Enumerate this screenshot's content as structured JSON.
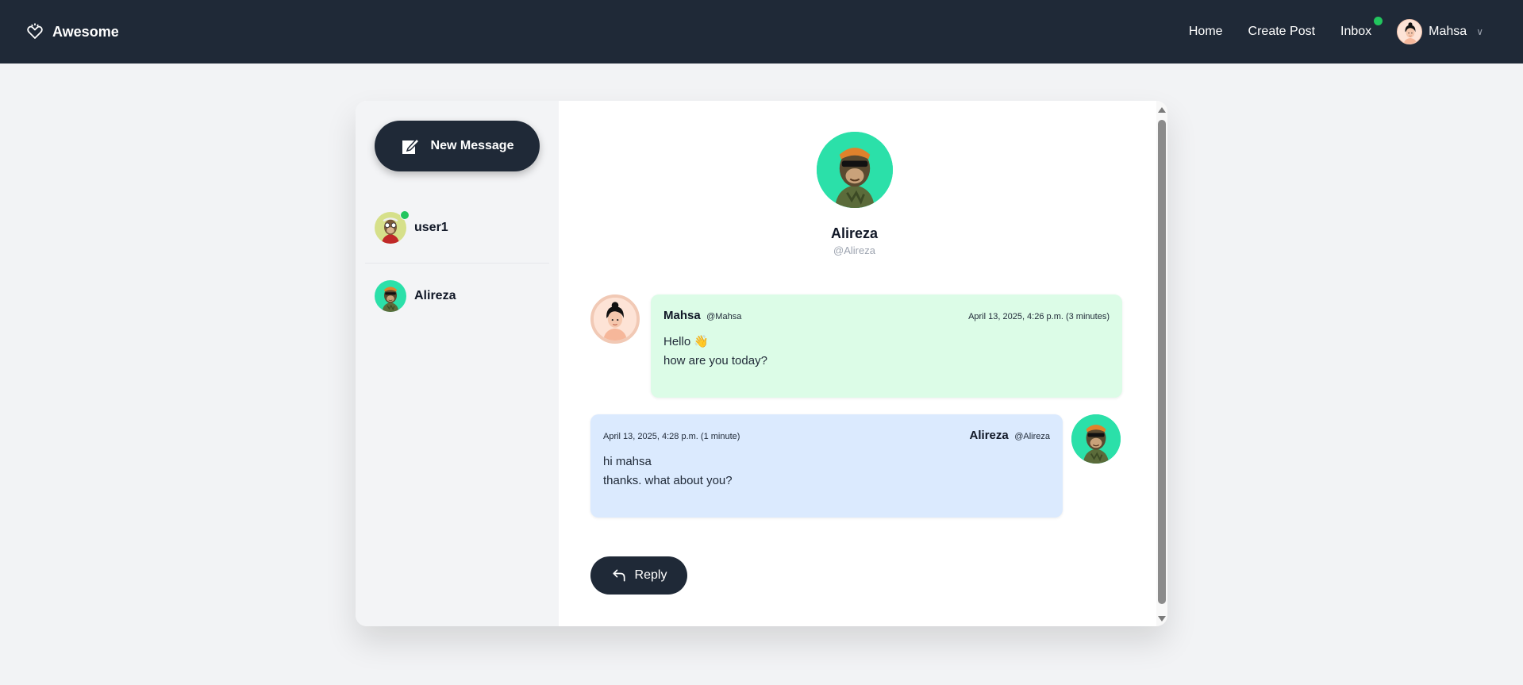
{
  "navbar": {
    "brand": "Awesome",
    "links": {
      "home": "Home",
      "create_post": "Create Post",
      "inbox": "Inbox"
    },
    "user_name": "Mahsa",
    "inbox_has_notification": true
  },
  "sidebar": {
    "new_message_label": "New Message",
    "conversations": [
      {
        "name": "user1",
        "online": true
      },
      {
        "name": "Alireza",
        "online": false
      }
    ]
  },
  "conversation": {
    "profile": {
      "name": "Alireza",
      "handle": "@Alireza"
    },
    "messages": [
      {
        "sender": "Mahsa",
        "handle": "@Mahsa",
        "time": "April 13, 2025, 4:26 p.m. (3 minutes)",
        "lines": [
          "Hello 👋",
          "how are you today?"
        ],
        "color": "#dcfce7"
      },
      {
        "sender": "Alireza",
        "handle": "@Alireza",
        "time": "April 13, 2025, 4:28 p.m. (1 minute)",
        "lines": [
          "hi mahsa",
          "thanks. what about you?"
        ],
        "color": "#dbeafe"
      }
    ],
    "reply_label": "Reply"
  },
  "colors": {
    "navbar": "#1f2937",
    "online": "#22c55e",
    "avatar_teal": "#2be0a9"
  },
  "icons": [
    "heart-logo-icon",
    "compose-icon",
    "reply-arrow-icon",
    "chevron-down-icon"
  ]
}
